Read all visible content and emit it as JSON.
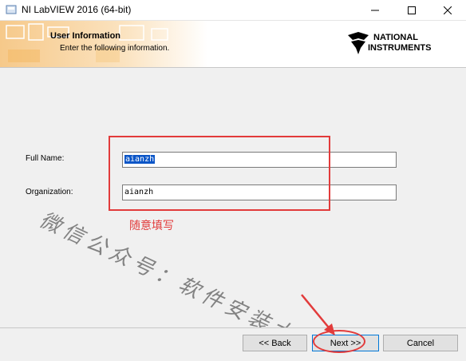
{
  "window": {
    "title": "NI LabVIEW 2016 (64-bit)",
    "controls": {
      "minimize": "minimize-icon",
      "maximize": "maximize-icon",
      "close": "close-icon"
    }
  },
  "banner": {
    "title": "User Information",
    "subtitle": "Enter the following information.",
    "logo_line1": "NATIONAL",
    "logo_line2": "INSTRUMENTS"
  },
  "form": {
    "full_name_label": "Full Name:",
    "full_name_value": "aianzh",
    "organization_label": "Organization:",
    "organization_value": "aianzh"
  },
  "annotations": {
    "note": "随意填写",
    "watermark": "微信公众号：软件安装大神",
    "color": "#e23b3b"
  },
  "buttons": {
    "back": "<< Back",
    "next": "Next >>",
    "cancel": "Cancel"
  }
}
